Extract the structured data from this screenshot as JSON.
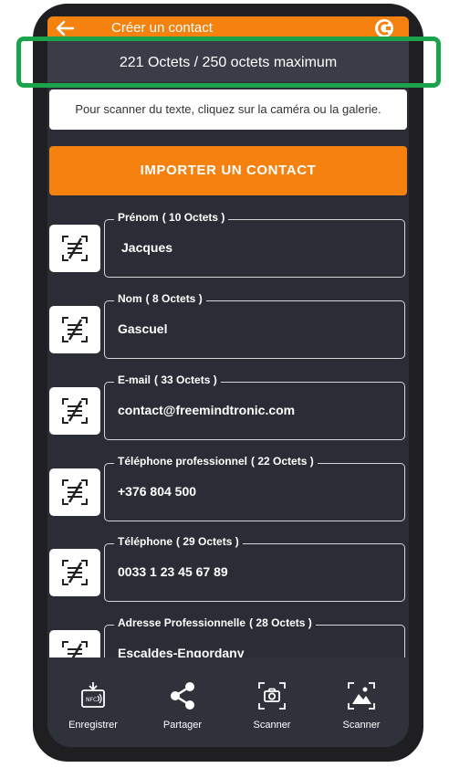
{
  "header": {
    "title": "Créer un contact"
  },
  "counter": {
    "text": "221 Octets / 250 octets maximum"
  },
  "hint": {
    "text": "Pour scanner du texte, cliquez sur la caméra ou la galerie."
  },
  "import_button": {
    "label": "IMPORTER UN CONTACT"
  },
  "fields": [
    {
      "label": "Prénom",
      "bytes": "( 10 Octets )",
      "value": "Jacques"
    },
    {
      "label": "Nom",
      "bytes": "( 8 Octets )",
      "value": "Gascuel"
    },
    {
      "label": "E-mail",
      "bytes": "( 33 Octets )",
      "value": "contact@freemindtronic.com"
    },
    {
      "label": "Téléphone professionnel",
      "bytes": "( 22 Octets )",
      "value": "+376 804 500"
    },
    {
      "label": "Téléphone",
      "bytes": "( 29 Octets )",
      "value": "0033 1 23  45 67 89"
    },
    {
      "label": "Adresse Professionnelle",
      "bytes": "( 28 Octets )",
      "value": "Escaldes-Engordany"
    }
  ],
  "nav": [
    {
      "label": "Enregistrer",
      "icon": "nfc-save-icon"
    },
    {
      "label": "Partager",
      "icon": "share-icon"
    },
    {
      "label": "Scanner",
      "icon": "camera-scan-icon"
    },
    {
      "label": "Scanner",
      "icon": "gallery-scan-icon"
    }
  ],
  "colors": {
    "accent": "#f5820f",
    "highlight": "#1aa34a",
    "background": "#2a2d36"
  }
}
